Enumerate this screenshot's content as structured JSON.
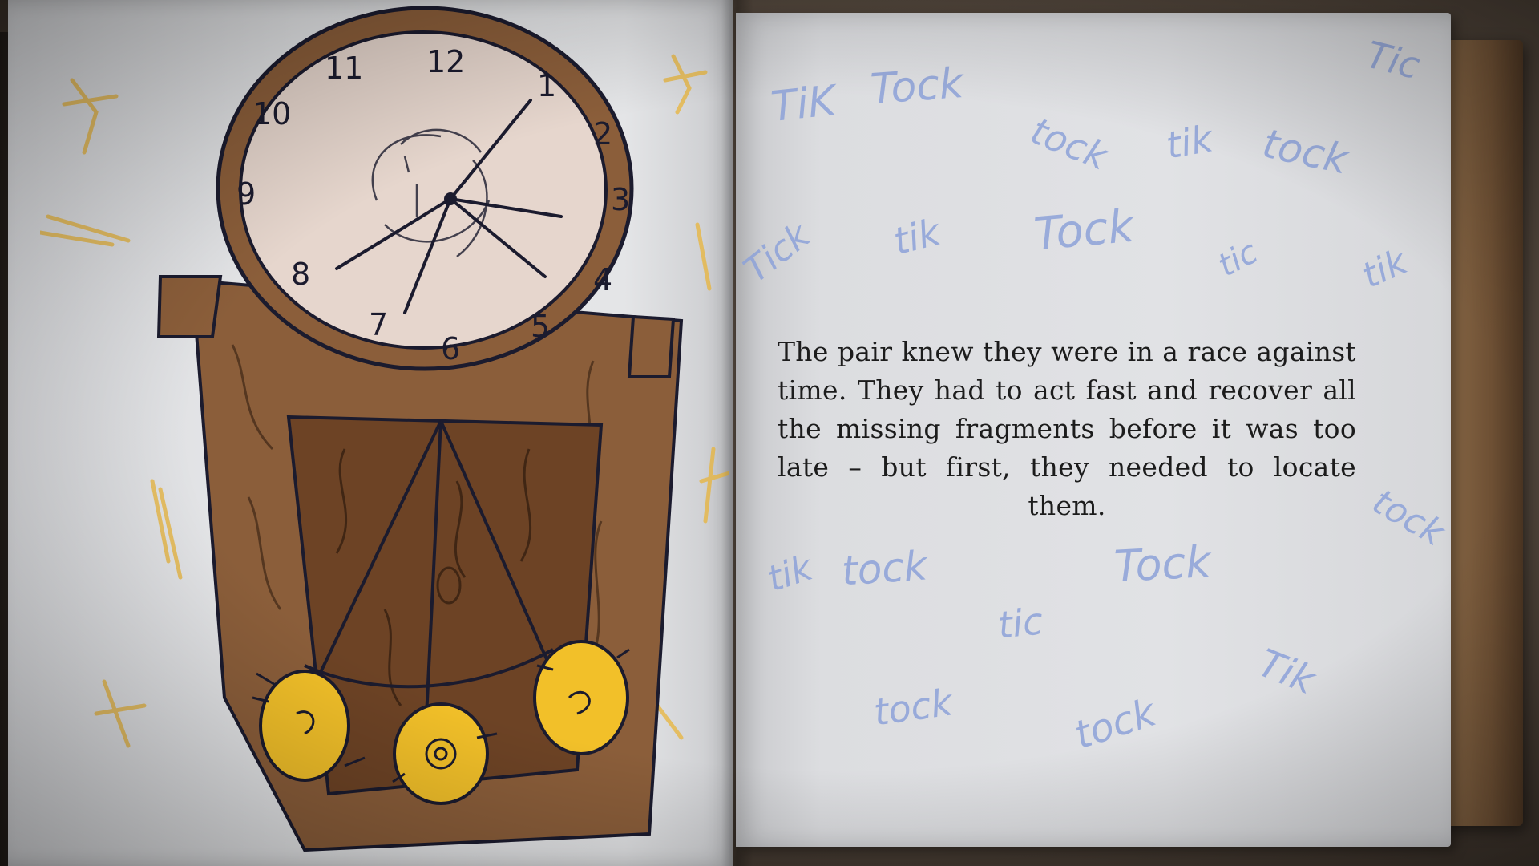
{
  "story": {
    "text": "The pair knew they were in a race against time. They had to act fast and recover all the missing fragments before it was too late – but first, they needed to locate them."
  },
  "doodles": [
    {
      "text": "TiK"
    },
    {
      "text": "Tock"
    },
    {
      "text": "tock"
    },
    {
      "text": "tik"
    },
    {
      "text": "tock"
    },
    {
      "text": "Tic"
    },
    {
      "text": "Tick"
    },
    {
      "text": "tik"
    },
    {
      "text": "Tock"
    },
    {
      "text": "tic"
    },
    {
      "text": "tik"
    },
    {
      "text": "tock"
    },
    {
      "text": "tik"
    },
    {
      "text": "tock"
    },
    {
      "text": "Tock"
    },
    {
      "text": "tic"
    },
    {
      "text": "tock"
    },
    {
      "text": "tock"
    },
    {
      "text": "Tik"
    }
  ],
  "clock": {
    "numerals": [
      "12",
      "1",
      "2",
      "3",
      "4",
      "5",
      "6",
      "7",
      "8",
      "9",
      "10",
      "11"
    ]
  },
  "colors": {
    "doodle": "#8da2d9",
    "wood": "#8b5e3a",
    "face": "#e6d6cd",
    "pendulum": "#f2c029"
  }
}
